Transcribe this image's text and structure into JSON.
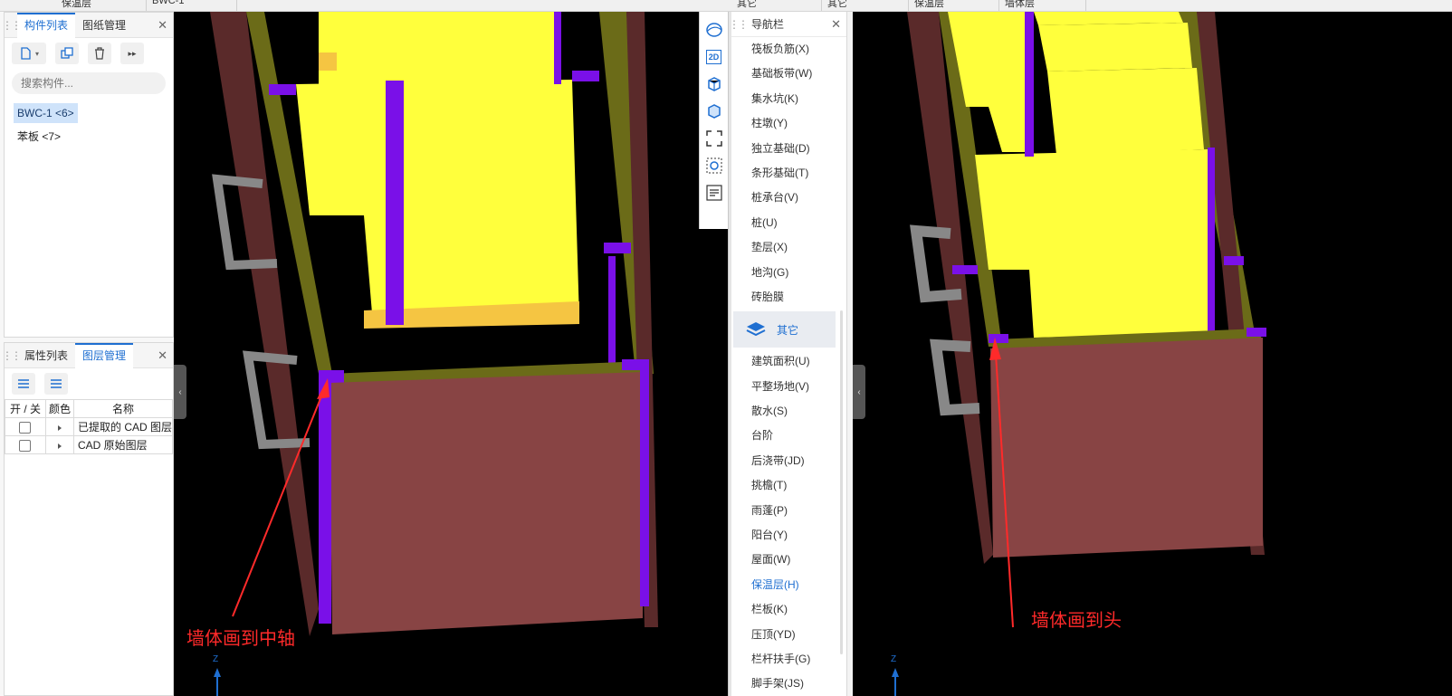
{
  "top_strip": [
    "保温层",
    "BWC-1",
    "其它",
    "其它",
    "保温层",
    "墙体层"
  ],
  "component_panel": {
    "tabs": [
      "构件列表",
      "图纸管理"
    ],
    "search_placeholder": "搜索构件...",
    "items": [
      "BWC-1 <6>",
      "苯板 <7>"
    ]
  },
  "layer_panel": {
    "tabs": [
      "属性列表",
      "图层管理"
    ],
    "columns": [
      "开 / 关",
      "颜色",
      "名称"
    ],
    "rows": [
      "已提取的 CAD 图层",
      "CAD 原始图层"
    ]
  },
  "nav_panel": {
    "title": "导航栏",
    "items_top": [
      "筏板负筋(X)",
      "基础板带(W)",
      "集水坑(K)",
      "柱墩(Y)",
      "独立基础(D)",
      "条形基础(T)",
      "桩承台(V)",
      "桩(U)",
      "垫层(X)",
      "地沟(G)",
      "砖胎膜"
    ],
    "group": "其它",
    "items_bottom": [
      "建筑面积(U)",
      "平整场地(V)",
      "散水(S)",
      "台阶",
      "后浇带(JD)",
      "挑檐(T)",
      "雨蓬(P)",
      "阳台(Y)",
      "屋面(W)",
      "保温层(H)",
      "栏板(K)",
      "压顶(YD)",
      "栏杆扶手(G)",
      "脚手架(JS)"
    ],
    "active_item": "保温层(H)"
  },
  "annotations": {
    "left": "墙体画到中轴",
    "right": "墙体画到头",
    "axis_z": "Z"
  },
  "view_tools": {
    "label_2d": "2D"
  },
  "colors": {
    "brick": "#884444",
    "yellow": "#ffff3c",
    "purple": "#7a10e8",
    "olive": "#6b6b18",
    "orange": "#f5c542",
    "accent": "#1f6fd1",
    "annotation": "#ff2a2a"
  }
}
